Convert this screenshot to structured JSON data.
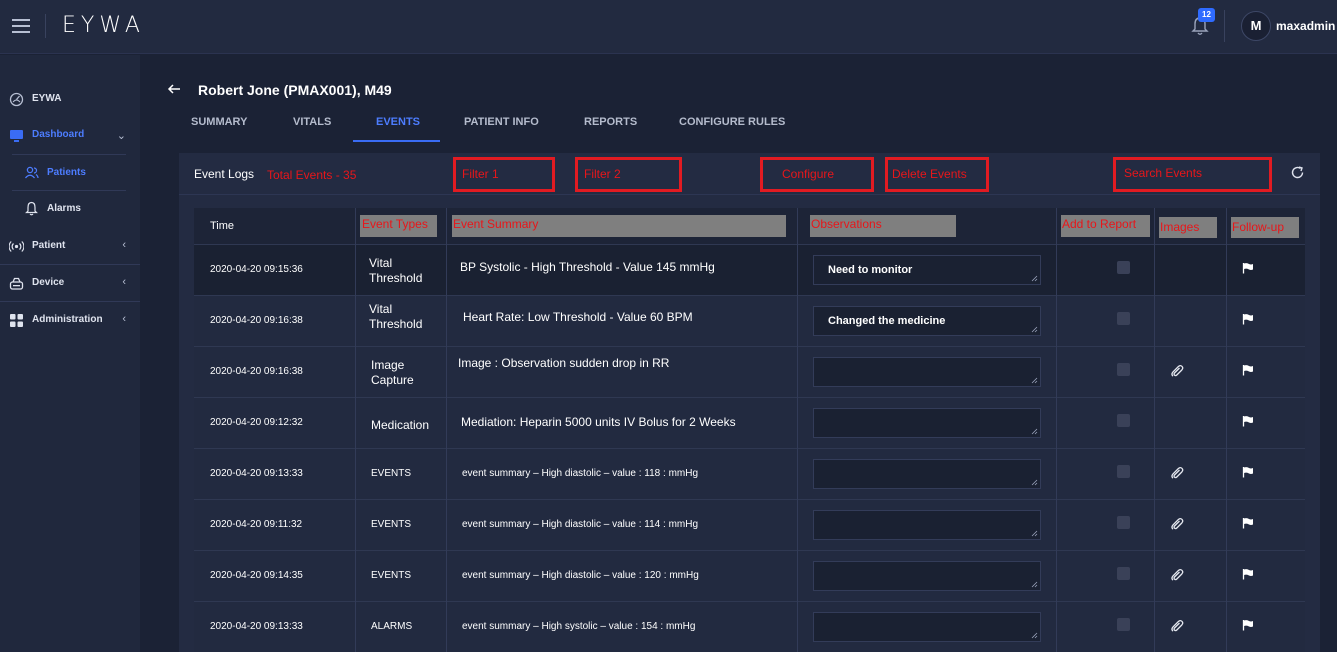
{
  "app": {
    "brand": "EYWA",
    "notifications_count": "12",
    "avatar_initial": "M",
    "username": "maxadmin"
  },
  "sidebar": {
    "items": [
      {
        "label": "EYWA"
      },
      {
        "label": "Dashboard"
      },
      {
        "label": "Patients"
      },
      {
        "label": "Alarms"
      },
      {
        "label": "Patient"
      },
      {
        "label": "Device"
      },
      {
        "label": "Administration"
      }
    ]
  },
  "page": {
    "title": "Robert Jone (PMAX001), M49",
    "tabs": [
      "SUMMARY",
      "VITALS",
      "EVENTS",
      "PATIENT INFO",
      "REPORTS",
      "CONFIGURE RULES"
    ],
    "active_tab": "EVENTS"
  },
  "events": {
    "title": "Event Logs",
    "total_label": "Total Events - 35",
    "filter1": "Filter 1",
    "filter2": "Filter 2",
    "configure": "Configure",
    "delete": "Delete Events",
    "search": "Search Events",
    "columns": {
      "time": "Time",
      "type": "Event Types",
      "summary": "Event Summary",
      "observations": "Observations",
      "add_report": "Add to Report",
      "images": "Images",
      "followup": "Follow-up"
    },
    "rows": [
      {
        "time": "2020-04-20 09:15:36",
        "type": "Vital\nThreshold",
        "summary": "BP Systolic - High Threshold - Value 145 mmHg",
        "obs": "Need to monitor",
        "image": false
      },
      {
        "time": "2020-04-20 09:16:38",
        "type": "Vital\nThreshold",
        "summary": "Heart Rate: Low Threshold - Value 60 BPM",
        "obs": "Changed the medicine",
        "image": false
      },
      {
        "time": "2020-04-20 09:16:38",
        "type": "Image\nCapture",
        "summary": "Image : Observation sudden drop in RR",
        "obs": "",
        "image": true
      },
      {
        "time": "2020-04-20 09:12:32",
        "type": "Medication",
        "summary": "Mediation: Heparin 5000 units IV Bolus for 2 Weeks",
        "obs": "",
        "image": false
      },
      {
        "time": "2020-04-20 09:13:33",
        "type": "EVENTS",
        "summary": "event summary – High diastolic – value : 118 : mmHg",
        "obs": "",
        "image": true
      },
      {
        "time": "2020-04-20 09:11:32",
        "type": "EVENTS",
        "summary": "event summary – High diastolic – value : 114 : mmHg",
        "obs": "",
        "image": true
      },
      {
        "time": "2020-04-20 09:14:35",
        "type": "EVENTS",
        "summary": "event summary – High diastolic – value : 120 : mmHg",
        "obs": "",
        "image": true
      },
      {
        "time": "2020-04-20 09:13:33",
        "type": "ALARMS",
        "summary": "event summary – High systolic – value : 154 : mmHg",
        "obs": "",
        "image": true
      }
    ]
  },
  "colors": {
    "accent": "#3a6cf4",
    "annotation_red": "#e8161a",
    "header_grey": "#7f7f7f",
    "background": "#1b2235"
  }
}
